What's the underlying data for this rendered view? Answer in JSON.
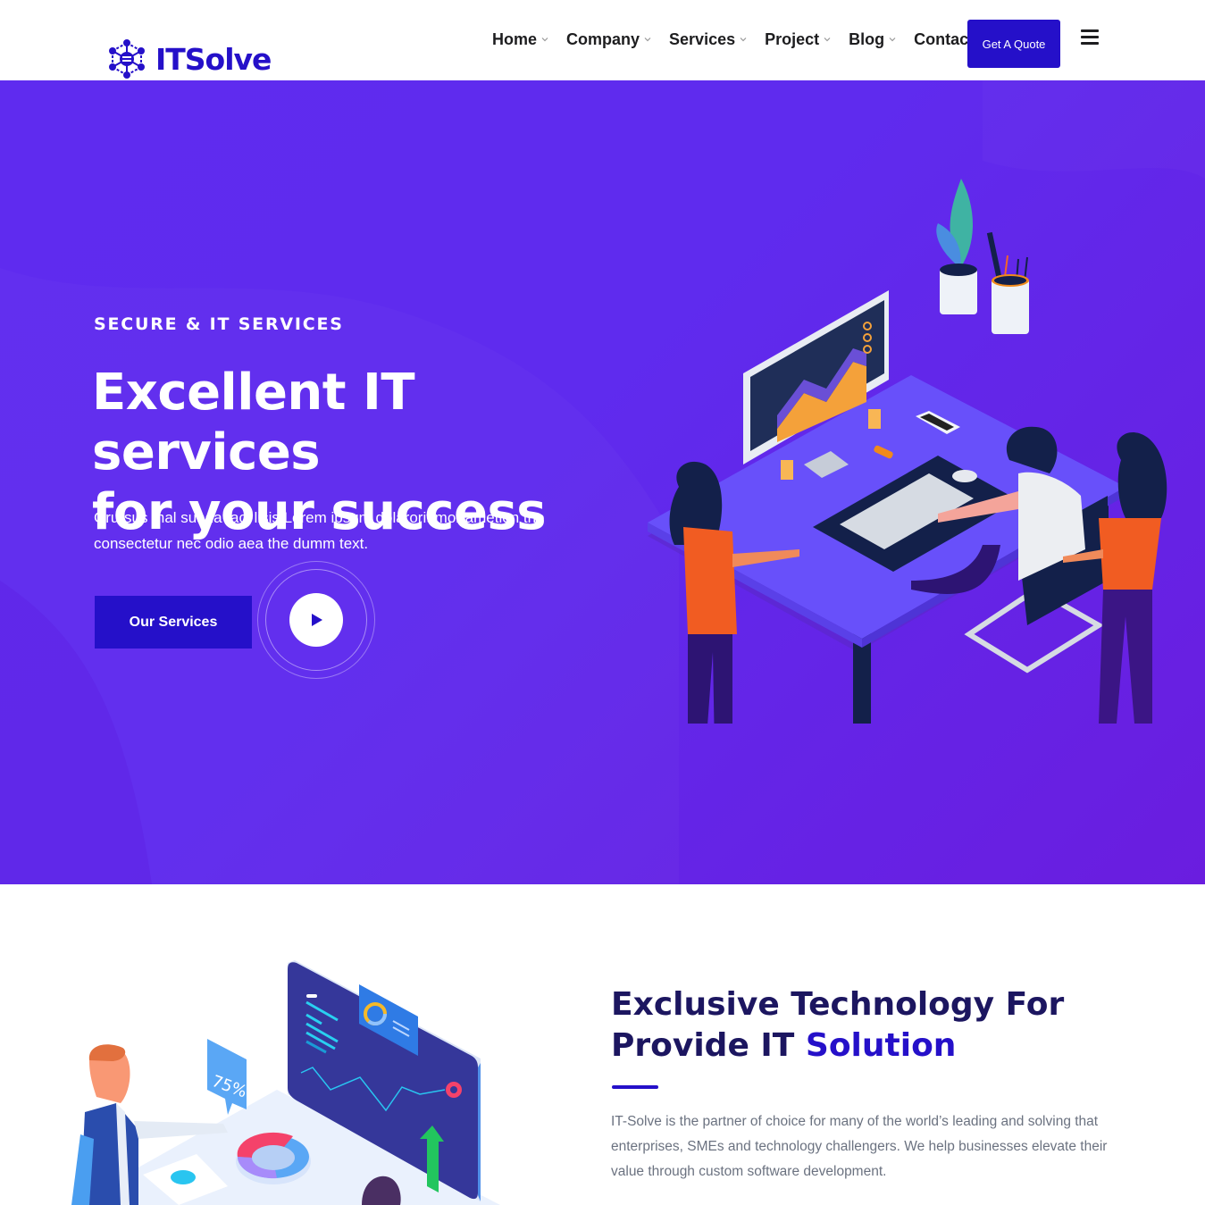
{
  "header": {
    "logo_text": "ITSolve",
    "nav": [
      {
        "label": "Home",
        "has_dropdown": true
      },
      {
        "label": "Company",
        "has_dropdown": true
      },
      {
        "label": "Services",
        "has_dropdown": true
      },
      {
        "label": "Project",
        "has_dropdown": true
      },
      {
        "label": "Blog",
        "has_dropdown": true
      },
      {
        "label": "Contact",
        "has_dropdown": false
      }
    ],
    "cta_label": "Get A Quote",
    "menu_icon": "hamburger-icon"
  },
  "hero": {
    "eyebrow": "SECURE & IT SERVICES",
    "title_line1": "Excellent IT services",
    "title_line2": "for your success",
    "description": "Grursus mal suada faci lisis Lorem ipsum dolarorit mor ametion the consectetur nec odio aea the dumm text.",
    "primary_button": "Our Services",
    "video_icon": "play-icon",
    "illustration": "team-working-at-desk-illustration"
  },
  "about": {
    "title_line1": "Exclusive Technology For",
    "title_line2_prefix": "Provide IT ",
    "title_line2_accent": "Solution",
    "description": "IT-Solve is the partner of choice for many of the world’s leading and solving that enterprises, SMEs and technology challengers. We help businesses elevate their value through custom software development.",
    "illustration": "analytics-dashboard-illustration",
    "illustration_badge": "75%"
  },
  "colors": {
    "brand": "#2510c9",
    "hero_gradient_start": "#5f2bef",
    "hero_gradient_end": "#6a1ddf",
    "heading_dark": "#1c1660",
    "body_text": "#6b7280"
  }
}
